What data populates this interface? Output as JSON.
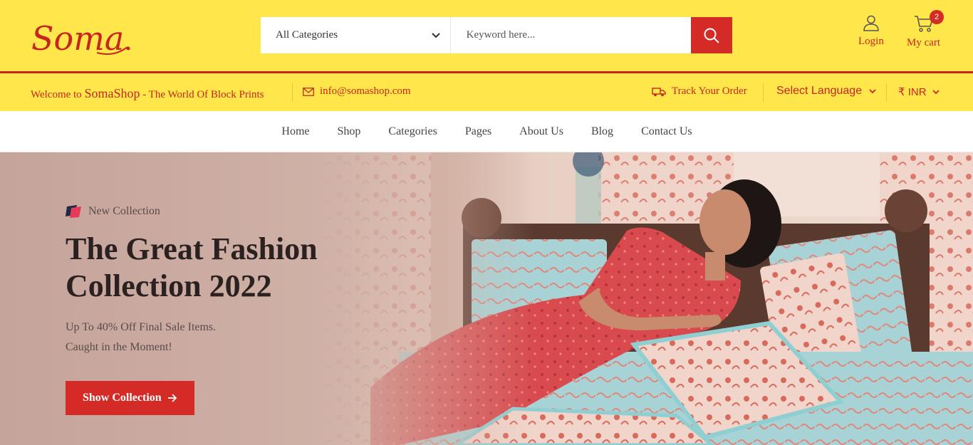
{
  "brand": {
    "logo_text": "Soma"
  },
  "search": {
    "category_selected": "All Categories",
    "placeholder": "Keyword here..."
  },
  "header": {
    "login_label": "Login",
    "cart_label": "My cart",
    "cart_count": "2"
  },
  "topbar": {
    "welcome_prefix": "Welcome to ",
    "welcome_brand": "SomaShop",
    "welcome_suffix": " - The World Of Block Prints",
    "email": "info@somashop.com",
    "track_label": "Track Your Order",
    "language_label": "Select Language",
    "currency_label": "₹ INR"
  },
  "nav": {
    "items": [
      "Home",
      "Shop",
      "Categories",
      "Pages",
      "About Us",
      "Blog",
      "Contact Us"
    ]
  },
  "hero": {
    "kicker": "New Collection",
    "headline_line1": "The Great Fashion",
    "headline_line2": "Collection 2022",
    "sub_line1": "Up To 40% Off Final Sale Items.",
    "sub_line2": "Caught in the Moment!",
    "cta_label": "Show Collection"
  },
  "colors": {
    "header_bg": "#ffe64a",
    "accent_red": "#d42b27",
    "text_red": "#c6261e"
  },
  "icons": [
    "chevron-down-icon",
    "search-icon",
    "user-icon",
    "cart-icon",
    "mail-icon",
    "truck-icon",
    "arrow-right-icon",
    "collection-badge-icon"
  ]
}
